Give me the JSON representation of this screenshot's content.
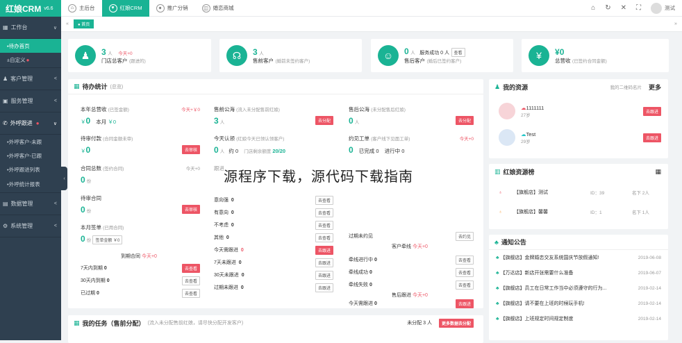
{
  "app": {
    "name": "红娘CRM",
    "version": "v6.6"
  },
  "sidebar": {
    "workbench": "工作台",
    "todo_home": "待办首页",
    "custom": "自定义",
    "customer_mgmt": "客户管理",
    "service_mgmt": "服务管理",
    "outbound": "外呼跟进",
    "sub": [
      "外呼客户-未跟",
      "外呼客户-已跟",
      "外呼跟进列表",
      "外呼统计报表"
    ],
    "data_mgmt": "数据管理",
    "system_mgmt": "系统管理"
  },
  "tabs": [
    "主后台",
    "红娘CRM",
    "推广分销",
    "婚恋商城"
  ],
  "user": "测试",
  "breadcrumb": "首页",
  "stats": [
    {
      "num": "3",
      "unit": "人",
      "extra": "今天+0",
      "label": "门店总客户",
      "sub": "(跟进的)"
    },
    {
      "num": "3",
      "unit": "人",
      "extra": "",
      "label": "售前客户",
      "sub": "(婚前未签约客户)"
    },
    {
      "num": "0",
      "unit": "人",
      "extra": "服务成功 0 人",
      "btn": "查看",
      "label": "售后客户",
      "sub": "(婚后已签约客户)"
    },
    {
      "num": "0",
      "unit": "",
      "extra": "",
      "label": "总营收",
      "sub": "(已签约合同金额)"
    }
  ],
  "todo": {
    "title": "待办统计",
    "subtitle": "(总览)",
    "col1": {
      "revenue_label": "本年总营收",
      "revenue_sub": "(已签金额)",
      "revenue_today": "今天+￥0",
      "revenue_val": "0",
      "month_label": "本月",
      "month_val": "￥0",
      "pay_label": "待审付款",
      "pay_sub": "(合同金额未审)",
      "pay_val": "0",
      "pay_btn": "去审核",
      "contract_label": "合同总数",
      "contract_sub": "(签约合同)",
      "contract_today": "今天+0",
      "contract_val": "0",
      "contract_unit": "份",
      "pending_label": "待审合同",
      "pending_val": "0",
      "pending_unit": "份",
      "pending_btn": "去审核",
      "month_sign_label": "本月签单",
      "month_sign_sub": "(已用合同)",
      "month_sign_val": "0",
      "month_sign_unit": "份",
      "month_sign_amount": "签单金额 ￥0",
      "expire_title": "到期合同",
      "expire_today": "今天+0",
      "expire_rows": [
        {
          "l": "7天内到期",
          "v": "0",
          "b": "去查看"
        },
        {
          "l": "30天内到期",
          "v": "0",
          "b": "去查看"
        },
        {
          "l": "已过期",
          "v": "0",
          "b": "去查看"
        }
      ]
    },
    "col2": {
      "pre_label": "售前公海",
      "pre_sub": "(流入未分配售前红娘)",
      "pre_val": "3",
      "pre_unit": "人",
      "pre_btn": "去分配",
      "today_label": "今天认领",
      "today_sub": "(红娘今天已领认领客户)",
      "today_val": "0",
      "today_unit": "人",
      "today_about": "约 0",
      "limit_label": "门店剩余额度",
      "limit_val": "20/20",
      "follow_label": "跟进",
      "intent_rows": [
        {
          "l": "意向强",
          "v": "0",
          "b": "去查看"
        },
        {
          "l": "有意向",
          "v": "0",
          "b": "去查看"
        },
        {
          "l": "不考虑",
          "v": "0",
          "b": "去查看"
        },
        {
          "l": "其他",
          "v": "0",
          "b": "去查看"
        }
      ],
      "today_follow": {
        "l": "今天需跟进",
        "v": "0",
        "b": "去跟进"
      },
      "follow_rows": [
        {
          "l": "7天未跟进",
          "v": "0",
          "b": "去跟进"
        },
        {
          "l": "30天未跟进",
          "v": "0",
          "b": "去跟进"
        },
        {
          "l": "过期未跟进",
          "v": "0",
          "b": "去跟进"
        }
      ]
    },
    "col3": {
      "post_label": "售后公海",
      "post_sub": "(未分配售后红娘)",
      "post_val": "0",
      "post_unit": "人",
      "post_btn": "去分配",
      "meet_label": "约见工单",
      "meet_sub": "(客户线下见面工单)",
      "meet_today": "今天+0",
      "meet_val": "0",
      "meet_done": "已完成 0",
      "meet_doing": "进行中 0",
      "overdue": "过期未约见",
      "overdue_btn": "去约见",
      "track_title": "客户牵线",
      "track_today": "今天+0",
      "track_rows": [
        {
          "l": "牵线进行中",
          "v": "0",
          "b": "去查看"
        },
        {
          "l": "牵线成功",
          "v": "0",
          "b": "去查看"
        },
        {
          "l": "牵线失败",
          "v": "0",
          "b": "去查看"
        }
      ],
      "after_title": "售后跟进",
      "after_today": "今天+0",
      "after_rows": [
        {
          "l": "今天需跟进",
          "v": "0",
          "b": "去跟进"
        },
        {
          "l": "7天未跟进",
          "v": "0",
          "b": "去跟进"
        },
        {
          "l": "过期未跟进",
          "v": "0",
          "b": "去跟进"
        }
      ]
    }
  },
  "resources": {
    "title": "我的资源",
    "qr": "我的二维码名片",
    "more": "更多",
    "items": [
      {
        "name": "1111111",
        "age": "27岁",
        "btn": "去跟进"
      },
      {
        "name": "Test",
        "age": "29岁",
        "btn": "去跟进"
      }
    ]
  },
  "ranking": {
    "title": "红娘资源榜",
    "rows": [
      {
        "name": "【旗舰店】测试",
        "id": "ID：39",
        "rank": "名下 2人"
      },
      {
        "name": "【旗舰店】馨馨",
        "id": "ID：1",
        "rank": "名下 1人"
      }
    ]
  },
  "notice": {
    "title": "通知公告",
    "rows": [
      {
        "t": "【旗舰店】金牌婚恋交友系统国庆节放假通知!",
        "d": "2019-06-08"
      },
      {
        "t": "【万达店】新店开张需要什么准备",
        "d": "2019-06-07"
      },
      {
        "t": "【旗舰店】员工在日常工作当中必须遵守的行为...",
        "d": "2019-02-14"
      },
      {
        "t": "【旗舰店】请不要在上班的时候玩手机!",
        "d": "2019-02-14"
      },
      {
        "t": "【旗舰店】上班规定时间规定制度",
        "d": "2019-02-14"
      }
    ]
  },
  "tasks": {
    "title": "我的任务（售前分配）",
    "sub": "(流入未分配售前红娘，请尽快分配开发客户)",
    "pending": "未分配 3 人",
    "btn": "更多数据去分配"
  },
  "watermark": "源程序下载，源代码下载指南",
  "colors": {
    "accent": "#1ab394",
    "sidebar": "#2f4050",
    "danger": "#ed5565"
  }
}
